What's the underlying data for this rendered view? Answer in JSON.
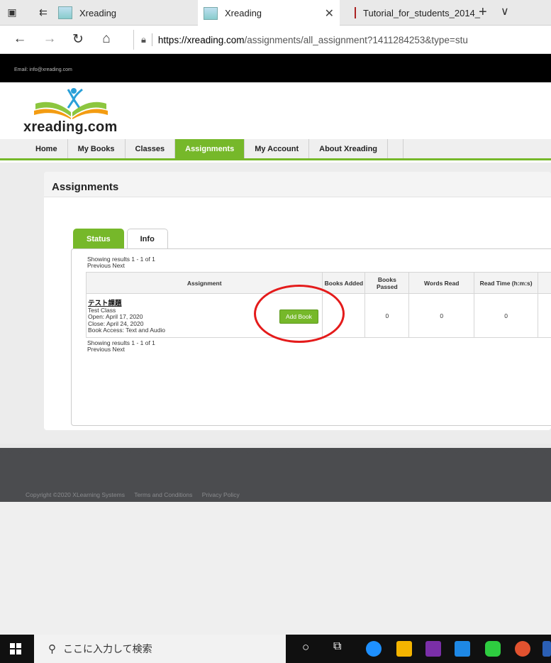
{
  "browser": {
    "tabs": [
      {
        "label": "Xreading"
      },
      {
        "label": "Xreading"
      },
      {
        "label": "Tutorial_for_students_2014_"
      }
    ],
    "new_tab": "+",
    "tab_menu": "∨",
    "url_domain": "https://xreading.com",
    "url_path": "/assignments/all_assignment?1411284253&type=stu"
  },
  "site": {
    "email_line": "Email: info@xreading.com",
    "logo_text": "xreading.com",
    "nav": [
      "Home",
      "My Books",
      "Classes",
      "Assignments",
      "My Account",
      "About Xreading"
    ],
    "active_nav": "Assignments"
  },
  "assignments": {
    "title": "Assignments",
    "tabs": [
      "Status",
      "Info"
    ],
    "paging_top": "Showing results 1 - 1 of 1",
    "paging_prev_next": "Previous Next",
    "columns": [
      "Assignment",
      "Books Added",
      "Books Passed",
      "Words Read",
      "Read Time (h:m:s)"
    ],
    "row": {
      "title": "テスト課題",
      "class": "Test Class",
      "open": "Open: April 17, 2020",
      "close": "Close: April 24, 2020",
      "access": "Book Access: Text and Audio",
      "add_book": "Add Book",
      "books_added": "",
      "books_passed": "0",
      "words_read": "0",
      "read_time": "0"
    },
    "paging_bottom": "Showing results 1 - 1 of 1",
    "paging_bottom_prev_next": "Previous Next"
  },
  "footer": {
    "copyright": "Copyright ©2020 XLearning Systems",
    "terms": "Terms and Conditions",
    "privacy": "Privacy Policy"
  },
  "taskbar": {
    "search_placeholder": "ここに入力して検索"
  },
  "colors": {
    "accent_green": "#76b82a",
    "annotation_red": "#e41b1b",
    "footer_gray": "#4b4c4f"
  }
}
